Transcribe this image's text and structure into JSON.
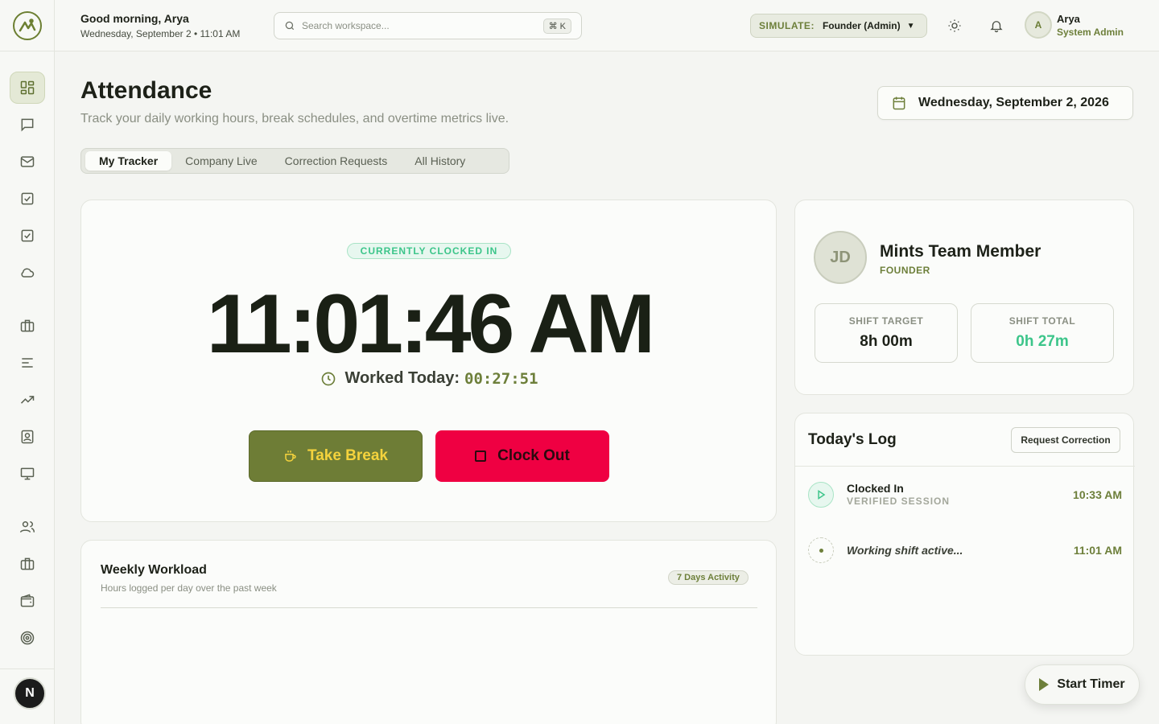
{
  "header": {
    "greeting": "Good morning, Arya",
    "datetime": "Wednesday, September 2 • 11:01 AM",
    "search_placeholder": "Search workspace...",
    "search_shortcut": "⌘ K",
    "simulate_label": "SIMULATE:",
    "simulate_value": "Founder (Admin)",
    "user_initial": "A",
    "user_name": "Arya",
    "user_role": "System Admin"
  },
  "page": {
    "title": "Attendance",
    "subtitle": "Track your daily working hours, break schedules, and overtime metrics live.",
    "date": "Wednesday, September 2, 2026"
  },
  "tabs": [
    {
      "label": "My Tracker",
      "active": true
    },
    {
      "label": "Company Live",
      "active": false
    },
    {
      "label": "Correction Requests",
      "active": false
    },
    {
      "label": "All History",
      "active": false
    }
  ],
  "tracker": {
    "status": "CURRENTLY CLOCKED IN",
    "time": "11:01:46 AM",
    "worked_label": "Worked Today:",
    "worked_value": "00:27:51",
    "break_label": "Take Break",
    "clockout_label": "Clock Out"
  },
  "weekly": {
    "title": "Weekly Workload",
    "subtitle": "Hours logged per day over the past week",
    "badge": "7 Days Activity"
  },
  "profile": {
    "initials": "JD",
    "name": "Mints Team Member",
    "role": "FOUNDER",
    "shift_target_label": "SHIFT TARGET",
    "shift_target_value": "8h 00m",
    "shift_total_label": "SHIFT TOTAL",
    "shift_total_value": "0h 27m"
  },
  "log": {
    "title": "Today's Log",
    "request_label": "Request Correction",
    "items": [
      {
        "name": "Clocked In",
        "meta": "VERIFIED SESSION",
        "time": "10:33 AM"
      },
      {
        "name": "Working shift active...",
        "meta": "",
        "time": "11:01 AM"
      }
    ]
  },
  "fab": {
    "label": "Start Timer"
  },
  "sidebar": {
    "badge": "N"
  },
  "colors": {
    "accent": "#6d7f3a",
    "success": "#3cc58a",
    "danger": "#ef0042",
    "warning": "#f5d33d"
  }
}
